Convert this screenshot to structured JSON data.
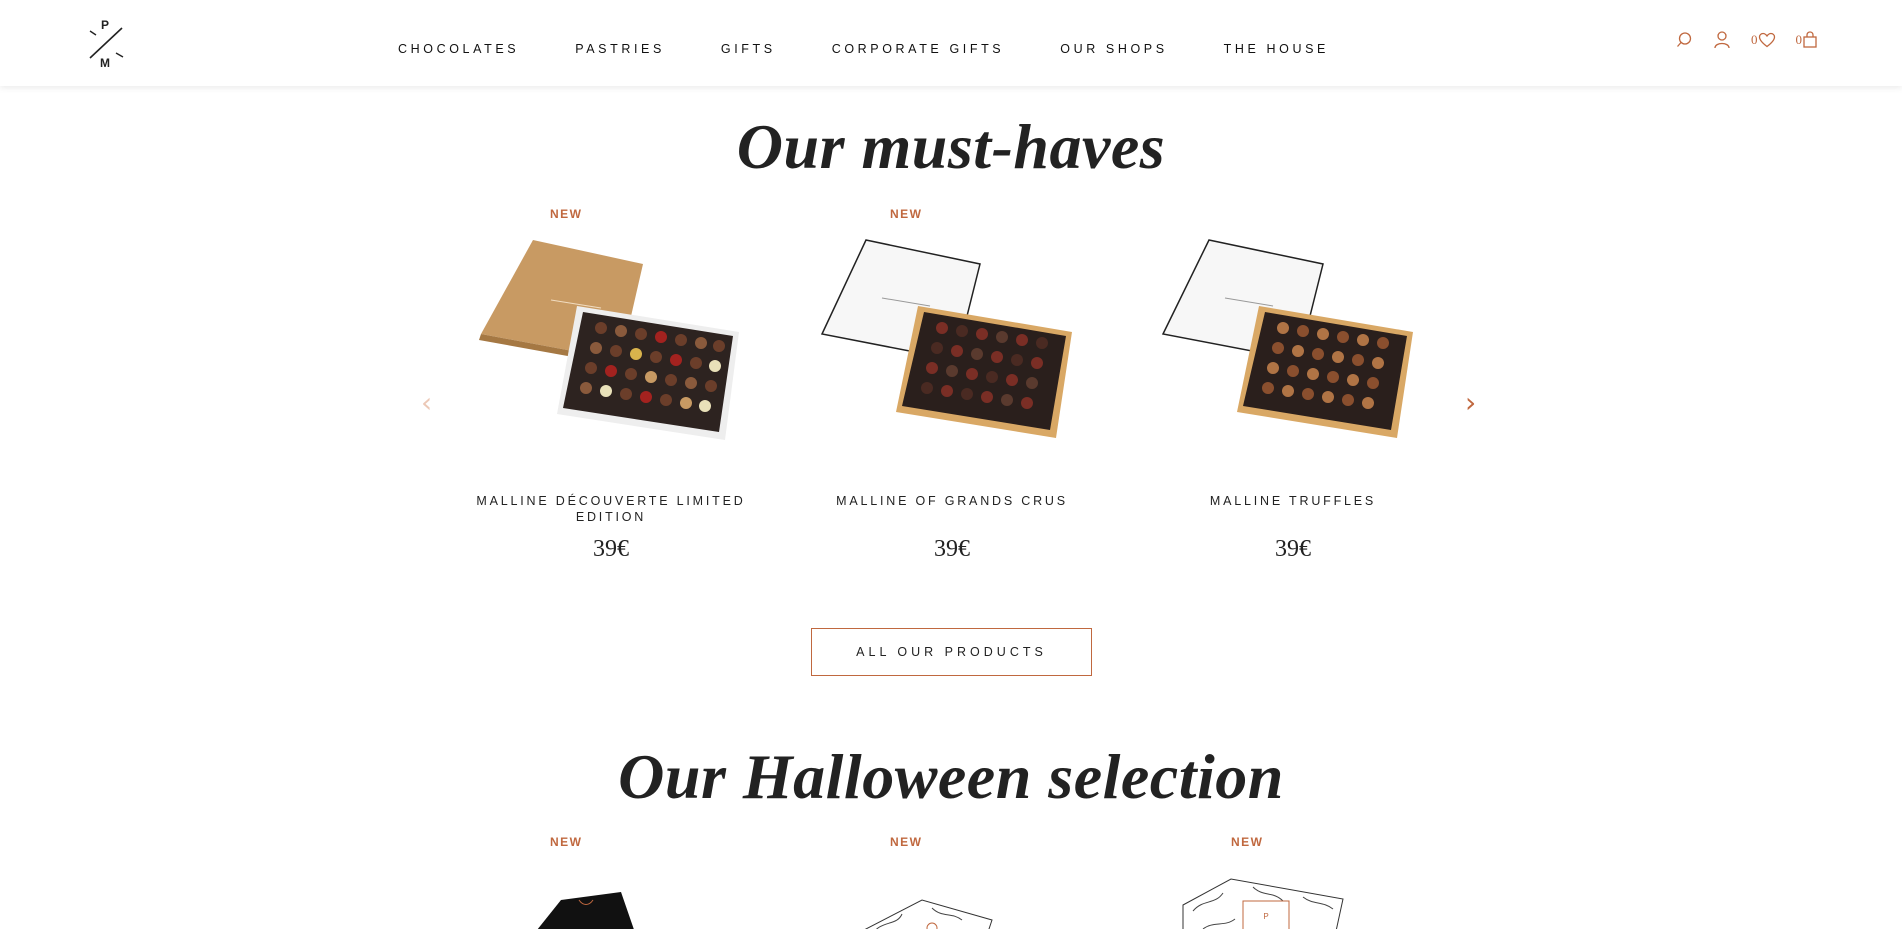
{
  "header": {
    "logo": {
      "top": "P",
      "bottom": "M"
    },
    "nav": [
      {
        "label": "CHOCOLATES"
      },
      {
        "label": "PASTRIES"
      },
      {
        "label": "GIFTS"
      },
      {
        "label": "CORPORATE GIFTS"
      },
      {
        "label": "OUR SHOPS"
      },
      {
        "label": "THE HOUSE"
      }
    ],
    "wishlist_count": "0",
    "cart_count": "0",
    "icons": [
      "search-icon",
      "account-icon",
      "heart-icon",
      "bag-icon"
    ],
    "accent": "#c0683f"
  },
  "must_haves": {
    "title": "Our must-haves",
    "products": [
      {
        "badge": "NEW",
        "name": "MALLINE DÉCOUVERTE LIMITED EDITION",
        "price": "39€"
      },
      {
        "badge": "NEW",
        "name": "MALLINE OF GRANDS CRUS",
        "price": "39€"
      },
      {
        "badge": "",
        "name": "MALLINE TRUFFLES",
        "price": "39€"
      }
    ],
    "button_label": "ALL OUR PRODUCTS"
  },
  "halloween": {
    "title": "Our Halloween selection",
    "products": [
      {
        "badge": "NEW"
      },
      {
        "badge": "NEW"
      },
      {
        "badge": "NEW"
      }
    ]
  }
}
